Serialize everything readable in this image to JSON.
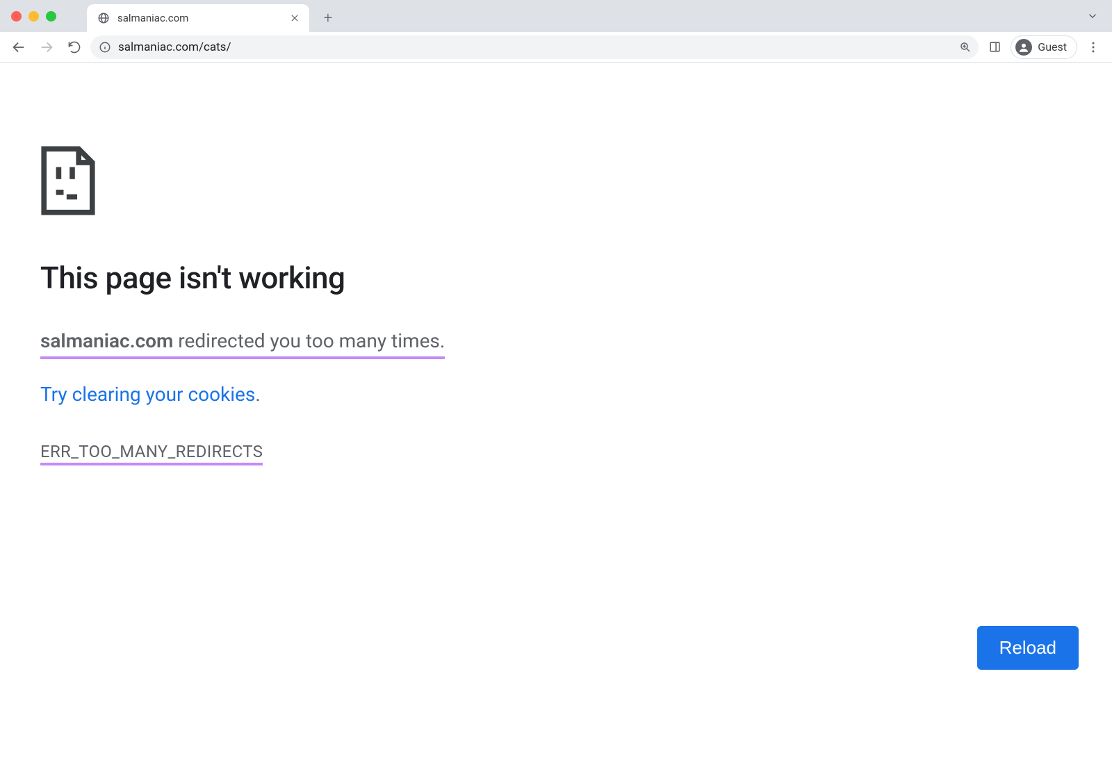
{
  "tab": {
    "title": "salmaniac.com"
  },
  "toolbar": {
    "url": "salmaniac.com/cats/",
    "profile_label": "Guest"
  },
  "error": {
    "title": "This page isn't working",
    "domain": "salmaniac.com",
    "message_suffix": " redirected you too many times. ",
    "link_text": "Try clearing your cookies",
    "link_suffix": ".",
    "code": "ERR_TOO_MANY_REDIRECTS",
    "reload_label": "Reload"
  }
}
